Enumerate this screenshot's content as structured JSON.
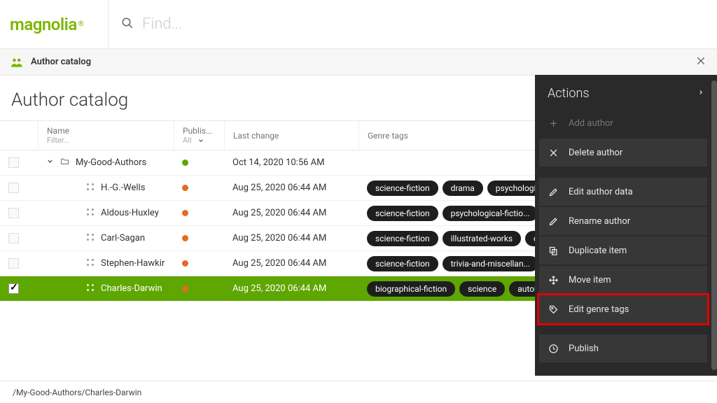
{
  "header": {
    "search_placeholder": "Find..."
  },
  "appbar": {
    "title": "Author catalog"
  },
  "page": {
    "title": "Author catalog"
  },
  "table": {
    "headers": {
      "name": "Name",
      "name_filter": "Filter...",
      "publish": "Publis...",
      "publish_filter": "All",
      "last_change": "Last change",
      "genre": "Genre tags"
    },
    "rows": [
      {
        "name": "My-Good-Authors",
        "type": "folder",
        "indent": 0,
        "expanded": true,
        "status": "green",
        "last_change": "Oct 14, 2020 10:56 AM",
        "tags": [],
        "selected": false
      },
      {
        "name": "H.-G.-Wells",
        "type": "item",
        "indent": 1,
        "status": "amber",
        "last_change": "Aug 25, 2020 06:44 AM",
        "tags": [
          "science-fiction",
          "drama",
          "psychological..."
        ],
        "selected": false
      },
      {
        "name": "Aldous-Huxley",
        "type": "item",
        "indent": 1,
        "status": "amber",
        "last_change": "Aug 25, 2020 06:44 AM",
        "tags": [
          "science-fiction",
          "psychological-fictio..."
        ],
        "selected": false
      },
      {
        "name": "Carl-Sagan",
        "type": "item",
        "indent": 1,
        "status": "amber",
        "last_change": "Aug 25, 2020 06:44 AM",
        "tags": [
          "science-fiction",
          "illustrated-works",
          "dra..."
        ],
        "selected": false
      },
      {
        "name": "Stephen-Hawkir",
        "type": "item",
        "indent": 1,
        "status": "amber",
        "last_change": "Aug 25, 2020 06:44 AM",
        "tags": [
          "science-fiction",
          "trivia-and-miscellan..."
        ],
        "selected": false
      },
      {
        "name": "Charles-Darwin",
        "type": "item",
        "indent": 1,
        "status": "amber",
        "last_change": "Aug 25, 2020 06:44 AM",
        "tags": [
          "biographical-fiction",
          "science",
          "autobiog..."
        ],
        "selected": true
      }
    ]
  },
  "breadcrumb": "/My-Good-Authors/Charles-Darwin",
  "actions": {
    "title": "Actions",
    "groups": [
      [
        {
          "key": "add",
          "label": "Add author",
          "icon": "plus",
          "disabled": true
        },
        {
          "key": "delete",
          "label": "Delete author",
          "icon": "x"
        }
      ],
      [
        {
          "key": "edit",
          "label": "Edit author data",
          "icon": "pencil"
        },
        {
          "key": "rename",
          "label": "Rename author",
          "icon": "pencil"
        },
        {
          "key": "duplicate",
          "label": "Duplicate item",
          "icon": "dup"
        },
        {
          "key": "move",
          "label": "Move item",
          "icon": "move"
        },
        {
          "key": "tags",
          "label": "Edit genre tags",
          "icon": "tag",
          "highlight": true
        }
      ],
      [
        {
          "key": "publish",
          "label": "Publish",
          "icon": "clock"
        }
      ]
    ]
  }
}
